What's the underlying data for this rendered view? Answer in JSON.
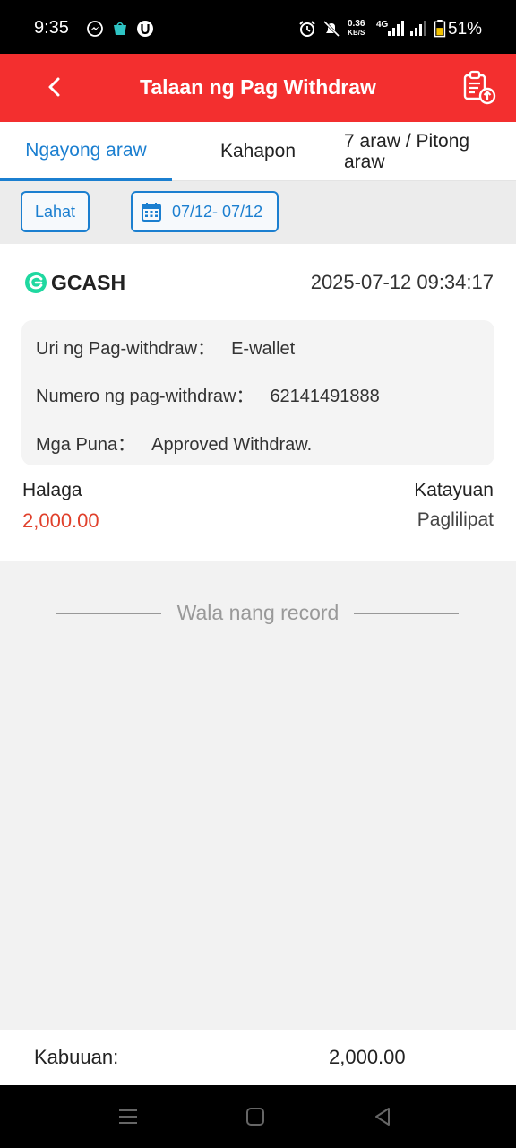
{
  "status_bar": {
    "time": "9:35",
    "speed_value": "0.36",
    "speed_unit": "KB/S",
    "network": "4G",
    "battery": "51%"
  },
  "header": {
    "title": "Talaan ng Pag Withdraw"
  },
  "tabs": [
    {
      "label": "Ngayong araw",
      "active": true
    },
    {
      "label": "Kahapon",
      "active": false
    },
    {
      "label": "7 araw / Pitong araw",
      "active": false
    }
  ],
  "filters": {
    "all_label": "Lahat",
    "date_range": "07/12- 07/12"
  },
  "record": {
    "provider": "GCASH",
    "datetime": "2025-07-12 09:34:17",
    "details": [
      {
        "label": "Uri ng Pag-withdraw：",
        "value": "E-wallet"
      },
      {
        "label": "Numero ng pag-withdraw：",
        "value": "62141491888"
      },
      {
        "label": "Mga Puna：",
        "value": "Approved Withdraw."
      }
    ],
    "amount_label": "Halaga",
    "amount": "2,000.00",
    "status_label": "Katayuan",
    "status": "Paglilipat"
  },
  "empty_text": "Wala nang record",
  "footer": {
    "total_label": "Kabuuan:",
    "total_value": "2,000.00"
  },
  "colors": {
    "header_red": "#f32f2f",
    "accent_blue": "#1b7fd0",
    "amount_red": "#e0402b",
    "gcash_green": "#1fd8a0"
  },
  "icons": [
    "back-arrow-icon",
    "clipboard-upload-icon",
    "calendar-icon",
    "gcash-logo-icon",
    "menu-icon",
    "home-icon",
    "back-triangle-icon"
  ]
}
